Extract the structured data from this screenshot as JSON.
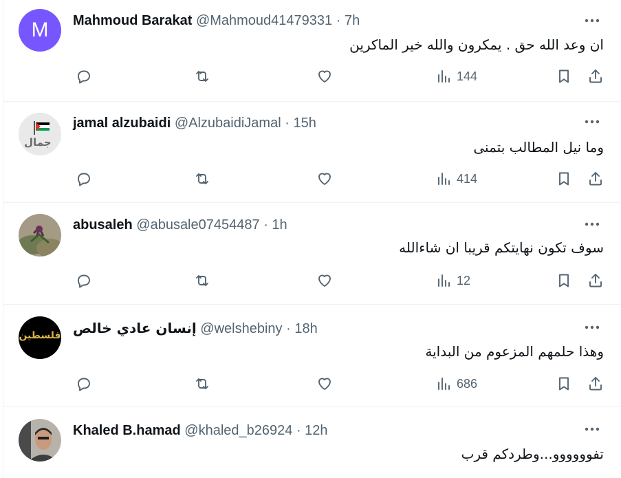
{
  "tweets": [
    {
      "name": "Mahmoud Barakat",
      "handle": "@Mahmoud41479331",
      "time": "7h",
      "avatar_letter": "M",
      "text": "ان وعد الله حق . يمكرون والله خير الماكرين",
      "views": "144"
    },
    {
      "name": "jamal alzubaidi",
      "handle": "@AlzubaidiJamal",
      "time": "15h",
      "avatar_text": "جمال",
      "text": "وما نيل المطالب بتمنى",
      "views": "414"
    },
    {
      "name": "abusaleh",
      "handle": "@abusale07454487",
      "time": "1h",
      "text": "سوف تكون نهايتكم قريبا ان شاءالله",
      "views": "12"
    },
    {
      "name": "إنسان عادي خالص",
      "handle": "@welshebiny",
      "time": "18h",
      "avatar_text": "فلسطين",
      "text": "وهذا حلمهم المزعوم من البداية",
      "views": "686"
    },
    {
      "name": "Khaled B.hamad",
      "handle": "@khaled_b26924",
      "time": "12h",
      "text": "تفوووووو...وطردكم قرب"
    }
  ],
  "separator": "·",
  "icons": {
    "reply": "reply-icon",
    "retweet": "retweet-icon",
    "like": "heart-icon",
    "views": "views-chart-icon",
    "bookmark": "bookmark-icon",
    "share": "share-icon",
    "more": "more-dots-icon"
  },
  "colors": {
    "avatar_m": "#7856ff",
    "secondary_text": "#536471"
  }
}
